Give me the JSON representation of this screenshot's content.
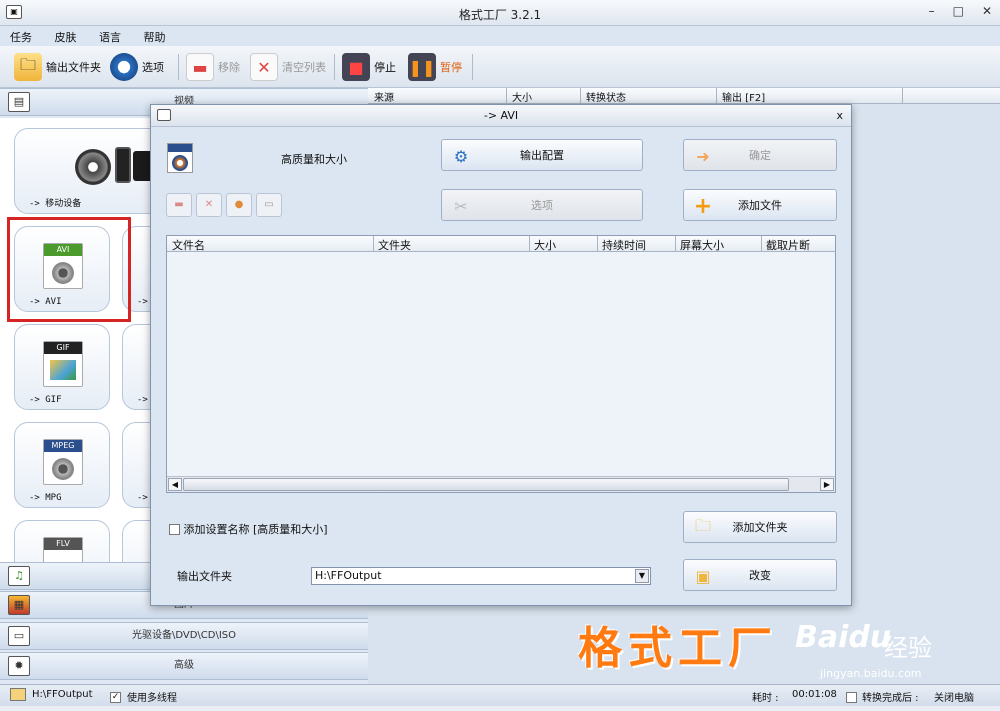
{
  "window": {
    "title": "格式工厂 3.2.1",
    "minimize": "–",
    "maximize": "□",
    "close": "✕"
  },
  "menu": [
    "任务",
    "皮肤",
    "语言",
    "帮助"
  ],
  "toolbar": {
    "output_folder": "输出文件夹",
    "options": "选项",
    "remove": "移除",
    "clear_list": "清空列表",
    "stop": "停止",
    "pause": "暂停"
  },
  "left": {
    "video_header": "视频",
    "tiles": {
      "mobile": "-> 移动设备",
      "avi": "-> AVI",
      "gif": "-> GIF",
      "mpg": "-> MPG",
      "avi_badge": "AVI",
      "gif_badge": "GIF",
      "mpeg_badge": "MPEG",
      "flv_badge": "FLV",
      "arrow": "->"
    },
    "audio_header": "",
    "image_header": "图片",
    "rom_header": "光驱设备\\DVD\\CD\\ISO",
    "advanced_header": "高级"
  },
  "list": {
    "columns": [
      "来源",
      "大小",
      "转换状态",
      "输出 [F2]"
    ]
  },
  "dialog": {
    "title": "-> AVI",
    "close": "x",
    "quality_label": "高质量和大小",
    "output_config": "输出配置",
    "ok": "确定",
    "options": "选项",
    "add_file": "添加文件",
    "columns": [
      "文件名",
      "文件夹",
      "大小",
      "持续时间",
      "屏幕大小",
      "截取片断"
    ],
    "add_setting_name": "添加设置名称 [高质量和大小]",
    "add_folder": "添加文件夹",
    "output_folder_label": "输出文件夹",
    "output_folder_value": "H:\\FFOutput",
    "change": "改变"
  },
  "status": {
    "path": "H:\\FFOutput",
    "multithread": "使用多线程",
    "elapsed_label": "耗时 :",
    "elapsed": "00:01:08",
    "after_convert": "转换完成后 :",
    "after_action": "关闭电脑"
  },
  "watermark": {
    "text": "格式工厂",
    "baidu": "Baidu",
    "jingyan": "经验",
    "url": "jingyan.baidu.com"
  }
}
